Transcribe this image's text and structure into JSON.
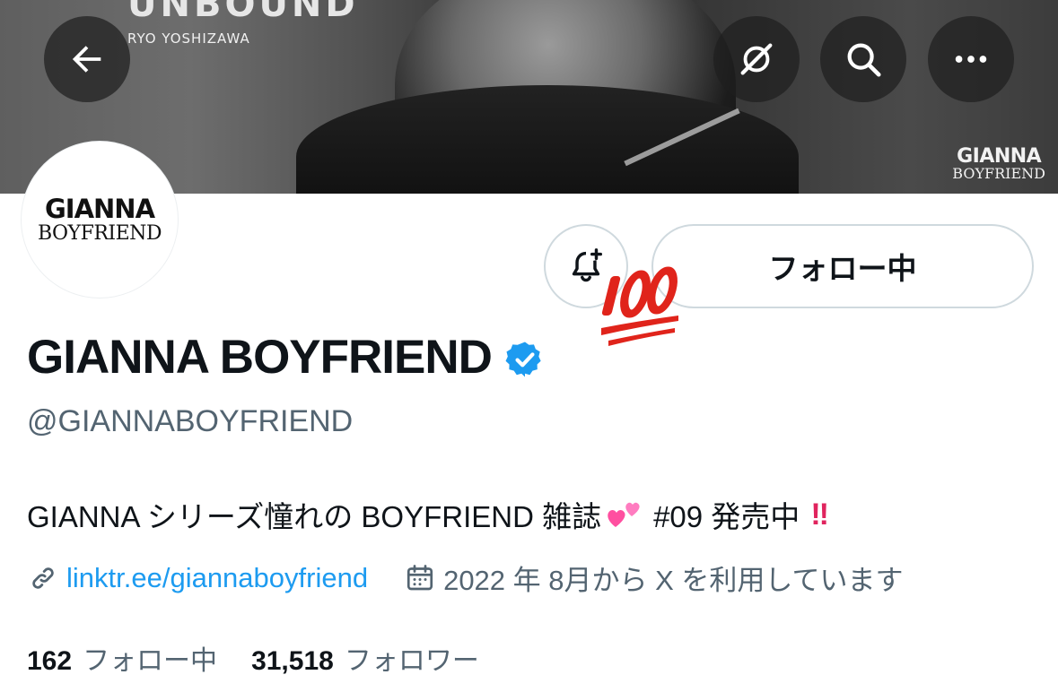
{
  "banner": {
    "title": "UNBOUND",
    "subtitle": "RYO YOSHIZAWA",
    "brand_line1": "GIANNA",
    "brand_line2": "BOYFRIEND"
  },
  "avatar": {
    "line1": "GIANNA",
    "line2": "BOYFRIEND"
  },
  "header_actions": {
    "back_icon": "arrow-left-icon",
    "grok_icon": "grok-icon",
    "search_icon": "search-icon",
    "more_icon": "more-horizontal-icon"
  },
  "profile": {
    "display_name": "GIANNA BOYFRIEND",
    "handle": "@GIANNABOYFRIEND",
    "verified": true,
    "follow_label": "フォロー中",
    "bio_part1": "GIANNA シリーズ憧れの BOYFRIEND 雑誌",
    "bio_part2": "#09 発売中",
    "bio_bang": "‼",
    "link": "linktr.ee/giannaboyfriend",
    "joined": "2022 年 8月から X を利用しています"
  },
  "stats": {
    "following_count": "162",
    "following_label": "フォロー中",
    "followers_count": "31,518",
    "followers_label": "フォロワー"
  },
  "colors": {
    "link": "#1d9bf0",
    "secondary_text": "#536471",
    "verified": "#1d9bf0",
    "border": "#cfd9de"
  }
}
